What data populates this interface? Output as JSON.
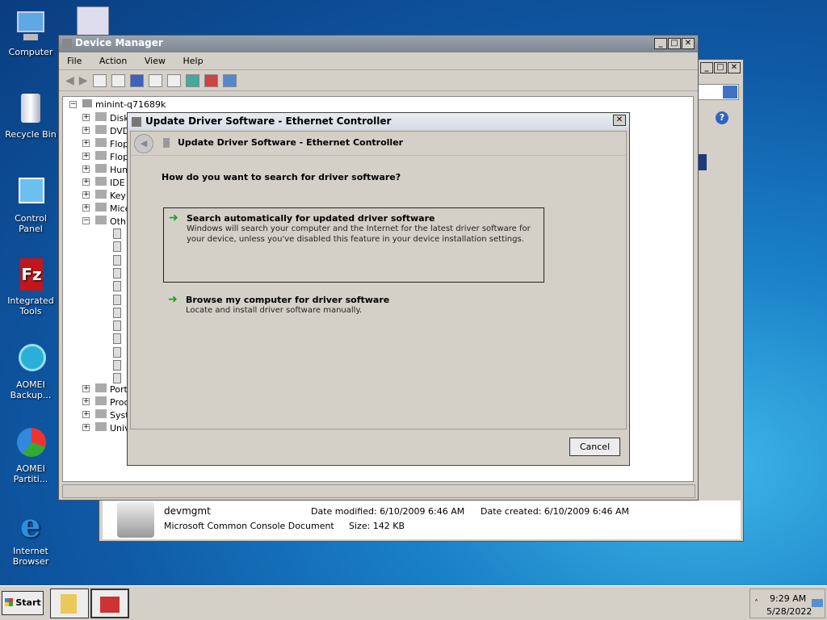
{
  "desktop": {
    "icons": [
      "Computer",
      "Recycle Bin",
      "Control Panel",
      "Integrated Tools",
      "AOMEI Backup...",
      "AOMEI Partiti...",
      "Internet Browser"
    ]
  },
  "devmgr": {
    "title": "Device Manager",
    "menus": [
      "File",
      "Action",
      "View",
      "Help"
    ],
    "root": "minint-q71689k",
    "nodes": [
      "Disk",
      "DVD",
      "Flop",
      "Flop",
      "Hum",
      "IDE",
      "Key",
      "Mice",
      "Oth",
      "Port",
      "Proc",
      "Syst",
      "Univ"
    ]
  },
  "dialog": {
    "title": "Update Driver Software - Ethernet Controller",
    "header": "Update Driver Software - Ethernet Controller",
    "question": "How do you want to search for driver software?",
    "opt1_title": "Search automatically for updated driver software",
    "opt1_desc": "Windows will search your computer and the Internet for the latest driver software for your device, unless you've disabled this feature in your device installation settings.",
    "opt2_title": "Browse my computer for driver software",
    "opt2_desc": "Locate and install driver software manually.",
    "cancel": "Cancel"
  },
  "explorer": {
    "file_name": "devmgmt",
    "file_type": "Microsoft Common Console Document",
    "modified": "Date modified: 6/10/2009 6:46 AM",
    "created": "Date created: 6/10/2009 6:46 AM",
    "size": "Size: 142 KB"
  },
  "taskbar": {
    "start": "Start",
    "time": "9:29 AM",
    "date": "5/28/2022"
  }
}
